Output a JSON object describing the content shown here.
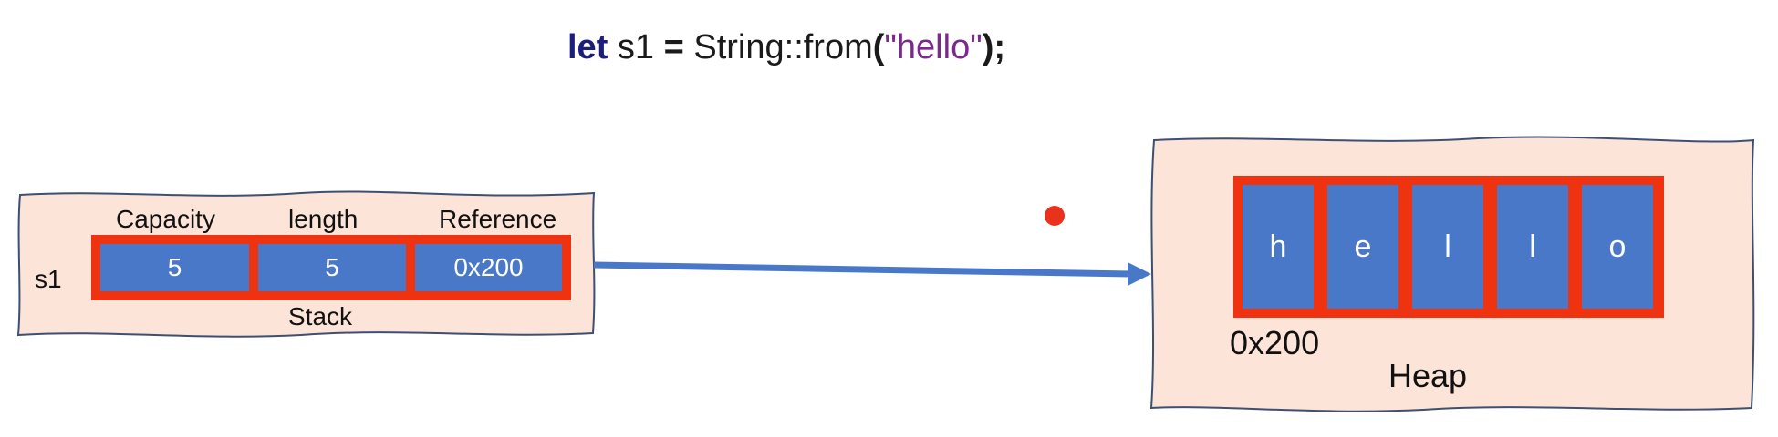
{
  "code": {
    "keyword": "let",
    "variable": " s1 ",
    "operator": "=",
    "call": " String::from",
    "open_paren": "(",
    "string_literal": "\"hello\"",
    "close": ");"
  },
  "stack": {
    "row_label": "s1",
    "headers": [
      "Capacity",
      "length",
      "Reference"
    ],
    "values": [
      "5",
      "5",
      "0x200"
    ],
    "caption": "Stack"
  },
  "heap": {
    "chars": [
      "h",
      "e",
      "l",
      "l",
      "o"
    ],
    "address": "0x200",
    "caption": "Heap"
  },
  "colors": {
    "panel_fill": "#fce4d8",
    "panel_border": "#3f4f73",
    "cell_fill": "#4a78c8",
    "cell_frame": "#ef3210",
    "arrow": "#4a78c8",
    "pointer_dot": "#e8321b",
    "keyword": "#1b1e7a",
    "string_literal": "#7a2a8a"
  }
}
